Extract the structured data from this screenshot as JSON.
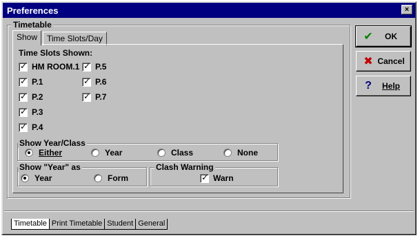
{
  "window": {
    "title": "Preferences",
    "close_label": "×"
  },
  "timetable_group": {
    "label": "Timetable"
  },
  "tabs": [
    {
      "label": "Show"
    },
    {
      "label": "Time Slots/Day"
    }
  ],
  "time_slots": {
    "label": "Time Slots Shown:",
    "col1": [
      {
        "label": "HM ROOM.1",
        "checked": true
      },
      {
        "label": "P.1",
        "checked": true
      },
      {
        "label": "P.2",
        "checked": true
      },
      {
        "label": "P.3",
        "checked": true
      },
      {
        "label": "P.4",
        "checked": true
      }
    ],
    "col2": [
      {
        "label": "P.5",
        "checked": true
      },
      {
        "label": "P.6",
        "checked": true
      },
      {
        "label": "P.7",
        "checked": true
      }
    ]
  },
  "show_year_class": {
    "label": "Show Year/Class",
    "options": [
      "Either",
      "Year",
      "Class",
      "None"
    ],
    "selected": "Either"
  },
  "show_year_as": {
    "label": "Show \"Year\" as",
    "options": [
      "Year",
      "Form"
    ],
    "selected": "Year"
  },
  "clash_warning": {
    "label": "Clash Warning",
    "checkbox_label": "Warn",
    "checked": true
  },
  "buttons": {
    "ok": "OK",
    "cancel": "Cancel",
    "help": "Help"
  },
  "bottom_tabs": [
    "Timetable",
    "Print Timetable",
    "Student",
    "General"
  ],
  "colors": {
    "titlebar": "#000080",
    "face": "#c0c0c0",
    "ok_icon": "#008000",
    "cancel_icon": "#c00000",
    "help_icon": "#000080"
  }
}
